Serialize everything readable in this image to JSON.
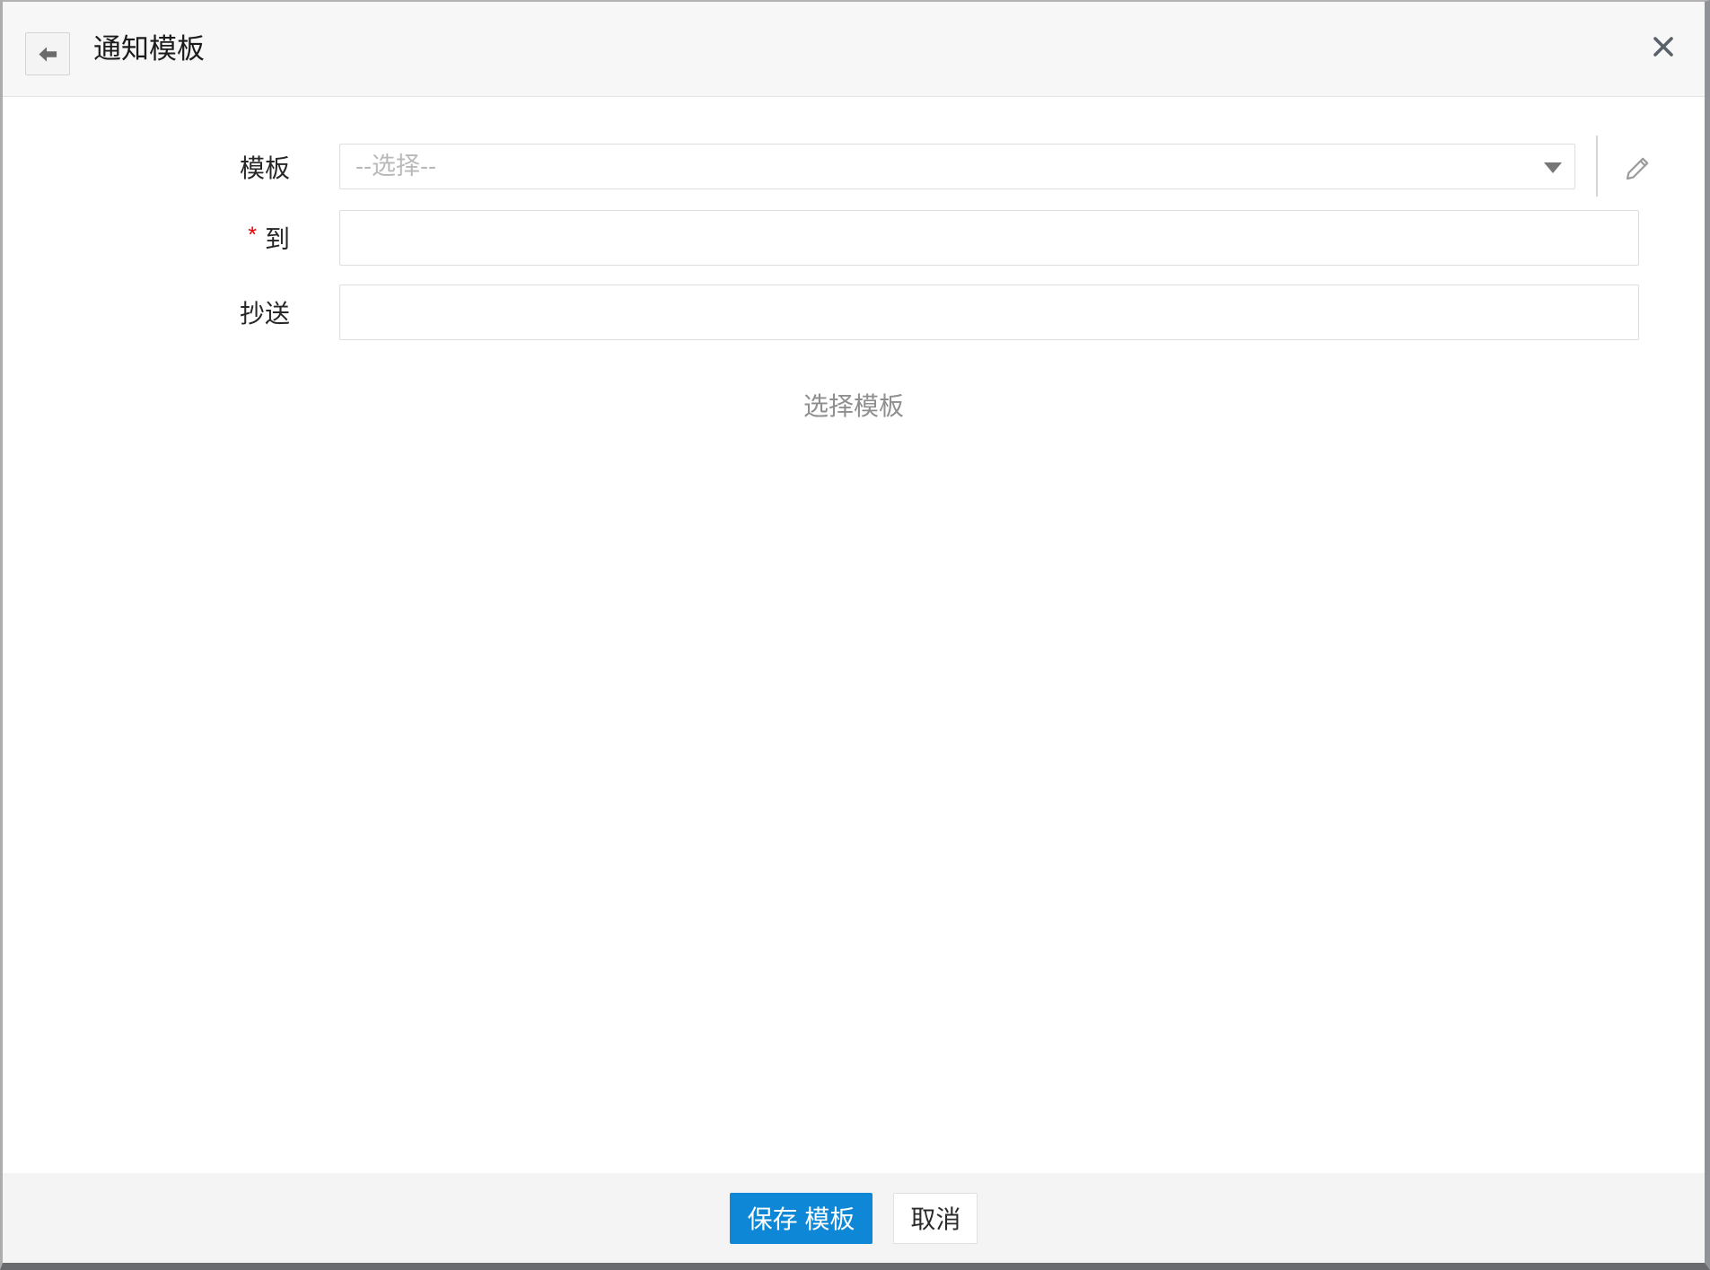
{
  "colors": {
    "accent_blue": "#0e88d6",
    "required_red": "#e60000"
  },
  "header": {
    "title": "通知模板",
    "back_icon": "arrow-left-icon",
    "close_icon": "close-icon"
  },
  "form": {
    "template": {
      "label": "模板",
      "placeholder": "--选择--",
      "value": "",
      "dropdown_icon": "chevron-down-icon",
      "edit_icon": "pencil-icon"
    },
    "to": {
      "label": "到",
      "required_marker": "*",
      "value": ""
    },
    "cc": {
      "label": "抄送",
      "value": ""
    },
    "hint_text": "选择模板"
  },
  "footer": {
    "save_label": "保存 模板",
    "cancel_label": "取消"
  }
}
